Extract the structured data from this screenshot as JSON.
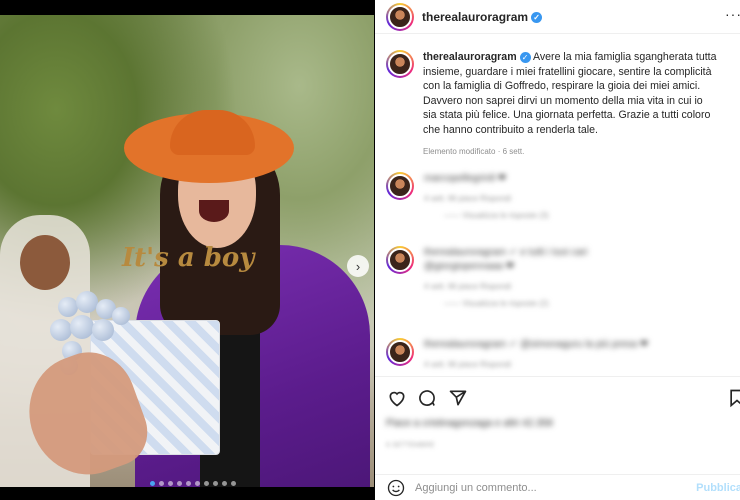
{
  "post": {
    "username": "therealauroragram",
    "caption": "Avere la mia famiglia sgangherata tutta insieme, guardare i miei fratellini giocare, sentire la complicità con la famiglia di Goffredo, respirare la gioia dei miei amici. Davvero non saprei dirvi un momento della mia vita in cui io sia stata più felice. Una giornata perfetta. Grazie a tutti coloro che hanno contribuito a renderla tale.",
    "edited": "Elemento modificato · 6 sett.",
    "more_label": "···",
    "next_arrow": "›",
    "image_dots": 10,
    "image_active_dot": 0,
    "topper_text": "It's a boy"
  },
  "comments": [
    {
      "text": "marcopellegrin8 ❤",
      "meta": "4 sett.    Mi piace    Rispondi",
      "sub": "—— Visualizza le risposte (3)"
    },
    {
      "text": "therealauroragram ✓ e tutti i tuoi cari @giorgiopennaaa ❤",
      "meta": "4 sett.    Mi piace    Rispondi",
      "sub": "—— Visualizza le risposte (2)"
    },
    {
      "text": "therealauroragram ✓ @simonaguru la più presa ❤",
      "meta": "4 sett.    Mi piace    Rispondi",
      "sub": ""
    }
  ],
  "likes_text": "Piace a cristinagonzaga e altri 42.358",
  "date_text": "6 SETTEMBRE",
  "add_comment": {
    "placeholder": "Aggiungi un commento...",
    "publish_label": "Pubblica"
  },
  "icons": {
    "like": "heart-icon",
    "comment": "comment-icon",
    "share": "share-icon",
    "save": "bookmark-icon",
    "emoji": "emoji-icon"
  },
  "colors": {
    "verified": "#3897f0",
    "link": "#b2dffc",
    "jacket": "#6b26a3",
    "hat": "#e2732a"
  }
}
